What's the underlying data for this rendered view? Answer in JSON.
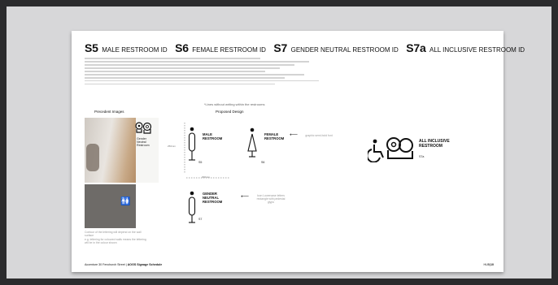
{
  "title": {
    "items": [
      {
        "code": "S5",
        "label": "MALE RESTROOM ID"
      },
      {
        "code": "S6",
        "label": "FEMALE RESTROOM ID"
      },
      {
        "code": "S7",
        "label": "GENDER NEUTRAL RESTROOM ID"
      },
      {
        "code": "S7a",
        "label": "ALL INCLUSIVE RESTROOM ID"
      }
    ]
  },
  "precedent": {
    "heading": "Precedent Images",
    "sign_text": "Gender Neutral Restroom",
    "caption_1": "Contour of the lettering will depend on the wall surface",
    "caption_2": "e.g. lettering for coloured walls means the lettering will be in the colour shown"
  },
  "proposed": {
    "note": "*Lines without writing within the restrooms",
    "heading": "Proposed Design",
    "male": {
      "line1": "MALE",
      "line2": "RESTROOM",
      "code": "S5",
      "dim_height": "250mm",
      "dim_width": "300mm"
    },
    "female": {
      "line1": "FEMALE",
      "line2": "RESTROOM",
      "code": "S6",
      "note": "graphic semi-bold font"
    },
    "neutral": {
      "line1": "GENDER",
      "line2": "NEUTRAL",
      "line3": "RESTROOM",
      "code": "S7",
      "note": "Icon Lowercase letters rectangle with pedestal glyps"
    },
    "inclusive": {
      "line1": "ALL INCLUSIVE",
      "line2": "RESTROOM",
      "code": "S7a"
    }
  },
  "footer": {
    "left": "Accenture 30 Fenchurch Street",
    "right": "AOGS Signage Schedule",
    "brand": "HUB",
    "page": "10"
  },
  "colors": {
    "background": "#2b2b2d",
    "frame": "#d7d7d9",
    "page": "#ffffff",
    "ink": "#111111"
  }
}
